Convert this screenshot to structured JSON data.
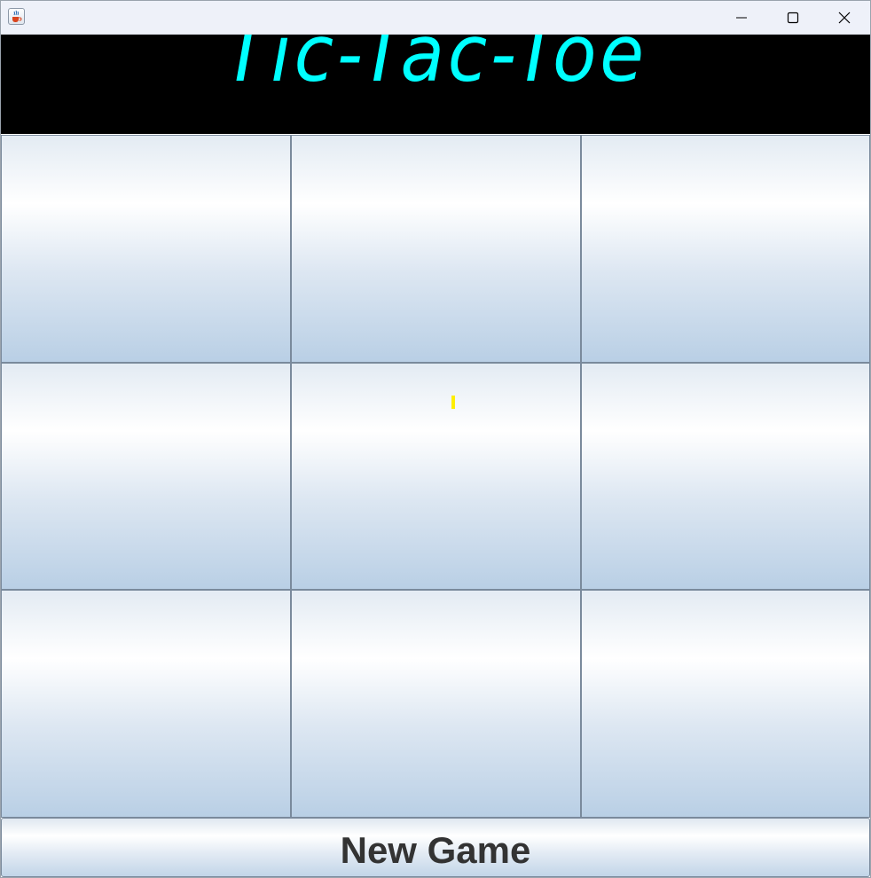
{
  "window": {
    "controls": {
      "minimize": "minimize-icon",
      "maximize": "maximize-icon",
      "close": "close-icon"
    },
    "app_icon": "java-coffee-cup-icon"
  },
  "header": {
    "title": "Tic-Tac-Toe",
    "title_color": "#00ffff",
    "background": "#000000"
  },
  "board": {
    "cells": [
      [
        "",
        "",
        ""
      ],
      [
        "",
        "",
        ""
      ],
      [
        "",
        "",
        ""
      ]
    ]
  },
  "footer": {
    "new_game_label": "New Game"
  }
}
